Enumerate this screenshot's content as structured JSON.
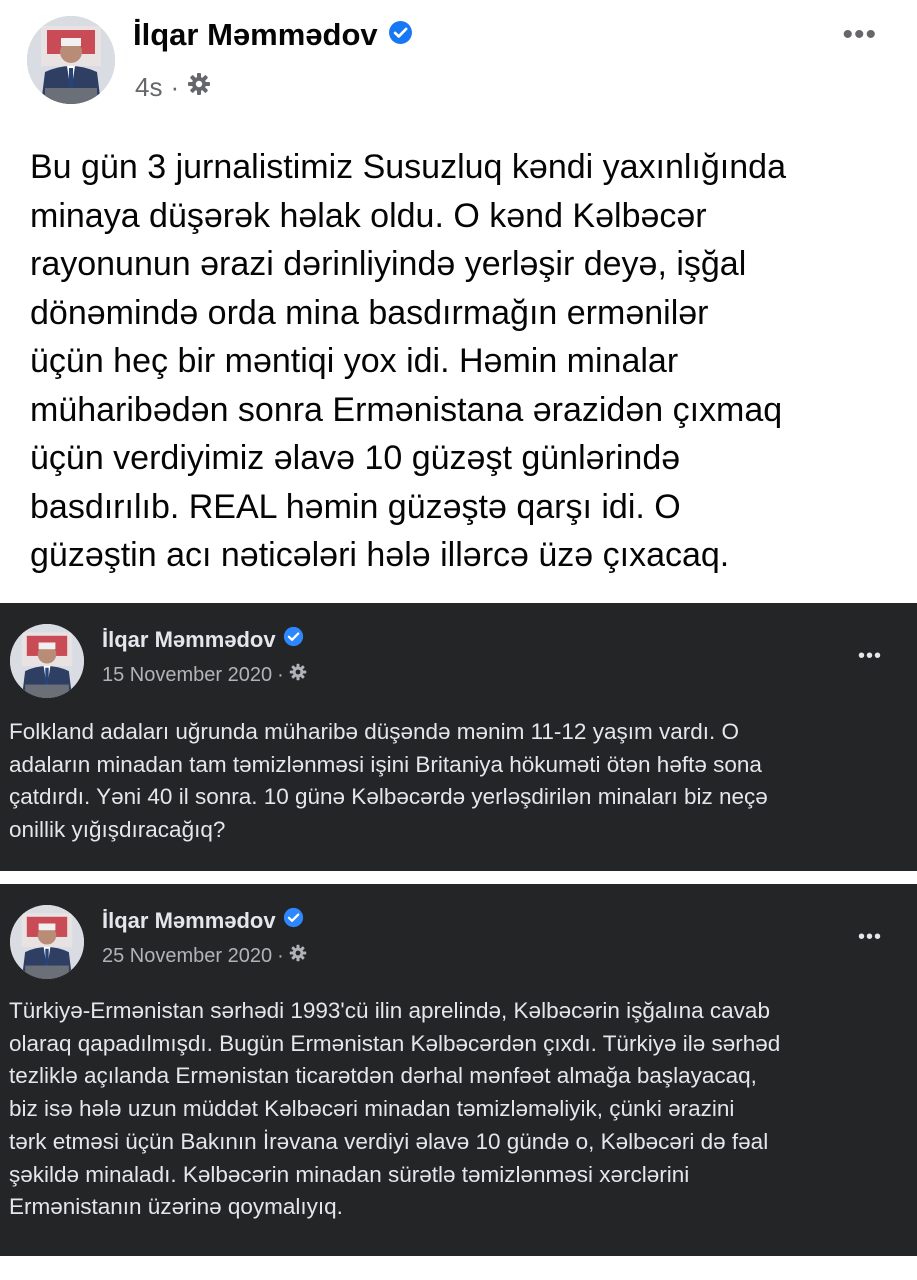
{
  "main_post": {
    "author": "İlqar Məmmədov",
    "time": "4s",
    "separator": "·",
    "more": "•••",
    "text": "Bu gün 3 jurnalistimiz Susuzluq kəndi yaxınlığında\nminaya düşərək həlak oldu. O kənd Kəlbəcər\nrayonunun ərazi dərinliyində yerləşir deyə, işğal\ndönəmində orda mina basdırmağın ermənilər\nüçün heç bir məntiqi yox idi.  Həmin minalar\nmüharibədən sonra Ermənistana ərazidən çıxmaq\nüçün verdiyimiz əlavə 10 güzəşt günlərində\nbasdırılıb. REAL həmin güzəştə qarşı idi. O\ngüzəştin acı nəticələri hələ illərcə üzə çıxacaq."
  },
  "shared_posts": [
    {
      "author": "İlqar Məmmədov",
      "date": "15 November 2020",
      "separator": "·",
      "more": "•••",
      "text": "Folkland adaları uğrunda müharibə düşəndə mənim 11-12 yaşım vardı. O\nadaların minadan tam təmizlənməsi işini Britaniya hökuməti ötən həftə sona\nçatdırdı. Yəni 40 il sonra. 10 günə Kəlbəcərdə yerləşdirilən minaları biz neçə\nonillik yığışdıracağıq?"
    },
    {
      "author": "İlqar Məmmədov",
      "date": "25 November 2020",
      "separator": "·",
      "more": "•••",
      "text": "Türkiyə-Ermənistan sərhədi 1993'cü ilin aprelində, Kəlbəcərin işğalına cavab\nolaraq qapadılmışdı. Bugün Ermənistan Kəlbəcərdən çıxdı. Türkiyə ilə sərhəd\ntezliklə açılanda Ermənistan ticarətdən dərhal mənfəət almağa başlayacaq,\nbiz isə hələ uzun müddət Kəlbəcəri minadan təmizləməliyik, çünki ərazini\ntərk etməsi üçün Bakının İrəvana verdiyi əlavə 10 gündə o, Kəlbəcəri də fəal\nşəkildə minaladı. Kəlbəcərin minadan sürətlə təmizlənməsi xərclərini\nErmənistanın üzərinə qoymalıyıq."
    }
  ],
  "icons": {
    "verified": "verified-badge-icon",
    "audience": "gear-icon",
    "more": "more-options-icon"
  },
  "colors": {
    "verified_blue": "#1877f2",
    "dark_bg": "#242526",
    "dark_text": "#e4e6eb",
    "meta_gray": "#65676b"
  }
}
